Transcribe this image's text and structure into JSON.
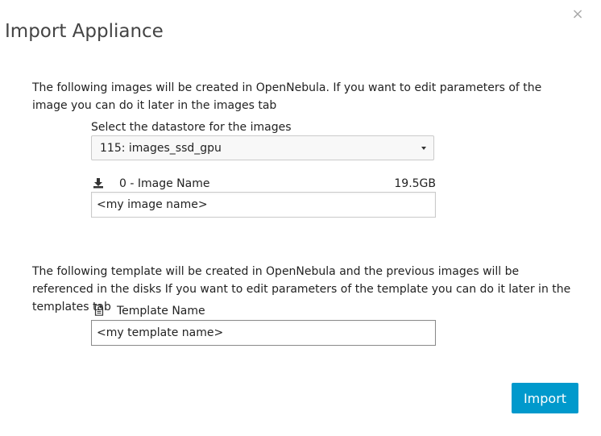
{
  "dialog": {
    "title": "Import Appliance",
    "close_symbol": "×",
    "close_icon": "close-icon"
  },
  "images_section": {
    "intro": "The following images will be created in OpenNebula. If you want to edit parameters of the image you can do it later in the images tab",
    "datastore_label": "Select the datastore for the images",
    "datastore_selected": "115: images_ssd_gpu",
    "image_icon": "download-icon",
    "image_label": "0 - Image Name",
    "image_size": "19.5GB",
    "image_name_value": "<my image name>"
  },
  "template_section": {
    "intro": "The following template will be created in OpenNebula and the previous images will be referenced in the disks If you want to edit parameters of the template you can do it later in the templates tab",
    "template_icon": "file-text-icon",
    "template_label": "Template Name",
    "template_name_value": "<my template name>"
  },
  "actions": {
    "import_label": "Import",
    "import_color": "#0099cc"
  }
}
